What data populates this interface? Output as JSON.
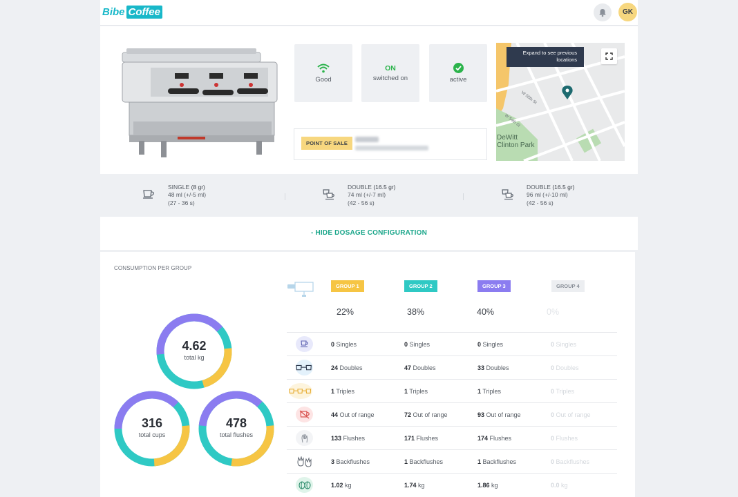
{
  "app": {
    "logo_part1": "Bibe",
    "logo_part2": "Coffee",
    "user_initials": "GK"
  },
  "machine": {
    "status": [
      {
        "value": "",
        "label": "Good",
        "icon": "wifi-icon"
      },
      {
        "value": "ON",
        "label": "switched on",
        "icon": ""
      },
      {
        "value": "",
        "label": "active",
        "icon": "check-circle-icon"
      }
    ],
    "point_of_sale_label": "POINT OF SALE",
    "map": {
      "tooltip": "Expand to see previous locations",
      "place_label_1": "DeWitt",
      "place_label_2": "Clinton Park",
      "street_1": "W 55th St",
      "street_2": "W 54th St"
    }
  },
  "dosage": {
    "items": [
      {
        "name": "SINGLE",
        "weight": "(8 gr)",
        "volume": "48 ml (+/-5 ml)",
        "time": "(27 - 36 s)"
      },
      {
        "name": "DOUBLE",
        "weight": "(16.5 gr)",
        "volume": "74 ml (+/-7 ml)",
        "time": "(42 - 56 s)"
      },
      {
        "name": "DOUBLE",
        "weight": "(16.5 gr)",
        "volume": "96 ml (+/-10 ml)",
        "time": "(42 - 56 s)"
      }
    ],
    "hide_label": "- HIDE DOSAGE CONFIGURATION"
  },
  "consumption": {
    "title": "CONSUMPTION PER GROUP",
    "donuts": [
      {
        "value": "4.62",
        "label": "total kg"
      },
      {
        "value": "316",
        "label": "total cups"
      },
      {
        "value": "478",
        "label": "total flushes"
      }
    ],
    "groups": [
      {
        "label": "GROUP 1",
        "color": "#f6c544",
        "percent": "22%"
      },
      {
        "label": "GROUP 2",
        "color": "#2fc9c4",
        "percent": "38%"
      },
      {
        "label": "GROUP 3",
        "color": "#8b7cf0",
        "percent": "40%"
      },
      {
        "label": "GROUP 4",
        "color": "#d4d8dd",
        "percent": "0%"
      }
    ],
    "rows": [
      {
        "icon": "single-cup-icon",
        "unit": "Singles",
        "values": [
          "0",
          "0",
          "0",
          "0"
        ]
      },
      {
        "icon": "double-cup-icon",
        "unit": "Doubles",
        "values": [
          "24",
          "47",
          "33",
          "0"
        ]
      },
      {
        "icon": "triple-cup-icon",
        "unit": "Triples",
        "values": [
          "1",
          "1",
          "1",
          "0"
        ]
      },
      {
        "icon": "out-of-range-icon",
        "unit": "Out of range",
        "values": [
          "44",
          "72",
          "93",
          "0"
        ]
      },
      {
        "icon": "flush-icon",
        "unit": "Flushes",
        "values": [
          "133",
          "171",
          "174",
          "0"
        ]
      },
      {
        "icon": "backflush-icon",
        "unit": "Backflushes",
        "values": [
          "3",
          "1",
          "1",
          "0"
        ]
      },
      {
        "icon": "coffee-bean-icon",
        "unit": "kg",
        "values": [
          "1.02",
          "1.74",
          "1.86",
          "0.0"
        ]
      }
    ]
  }
}
